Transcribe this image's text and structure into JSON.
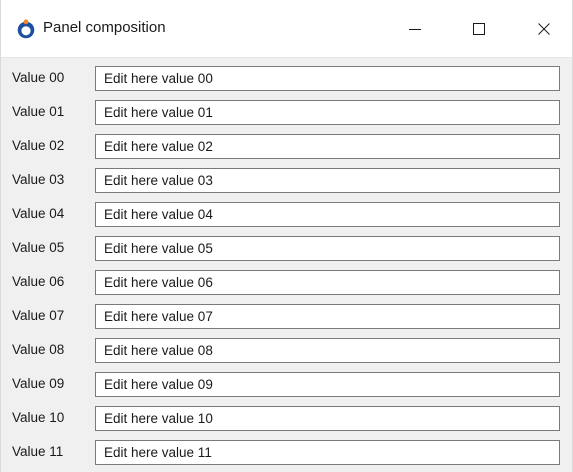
{
  "window": {
    "title": "Panel composition",
    "icon": "app-logo-icon",
    "controls": {
      "minimize_icon": "minimize-icon",
      "maximize_icon": "maximize-icon",
      "close_icon": "close-icon"
    },
    "colors": {
      "logo_blue": "#1e4fa0",
      "logo_orange": "#f08a24",
      "background": "#f0f0f0",
      "titlebar": "#ffffff"
    }
  },
  "rows": [
    {
      "label": "Value 00",
      "value": "Edit here value 00"
    },
    {
      "label": "Value 01",
      "value": "Edit here value 01"
    },
    {
      "label": "Value 02",
      "value": "Edit here value 02"
    },
    {
      "label": "Value 03",
      "value": "Edit here value 03"
    },
    {
      "label": "Value 04",
      "value": "Edit here value 04"
    },
    {
      "label": "Value 05",
      "value": "Edit here value 05"
    },
    {
      "label": "Value 06",
      "value": "Edit here value 06"
    },
    {
      "label": "Value 07",
      "value": "Edit here value 07"
    },
    {
      "label": "Value 08",
      "value": "Edit here value 08"
    },
    {
      "label": "Value 09",
      "value": "Edit here value 09"
    },
    {
      "label": "Value 10",
      "value": "Edit here value 10"
    },
    {
      "label": "Value 11",
      "value": "Edit here value 11"
    }
  ]
}
